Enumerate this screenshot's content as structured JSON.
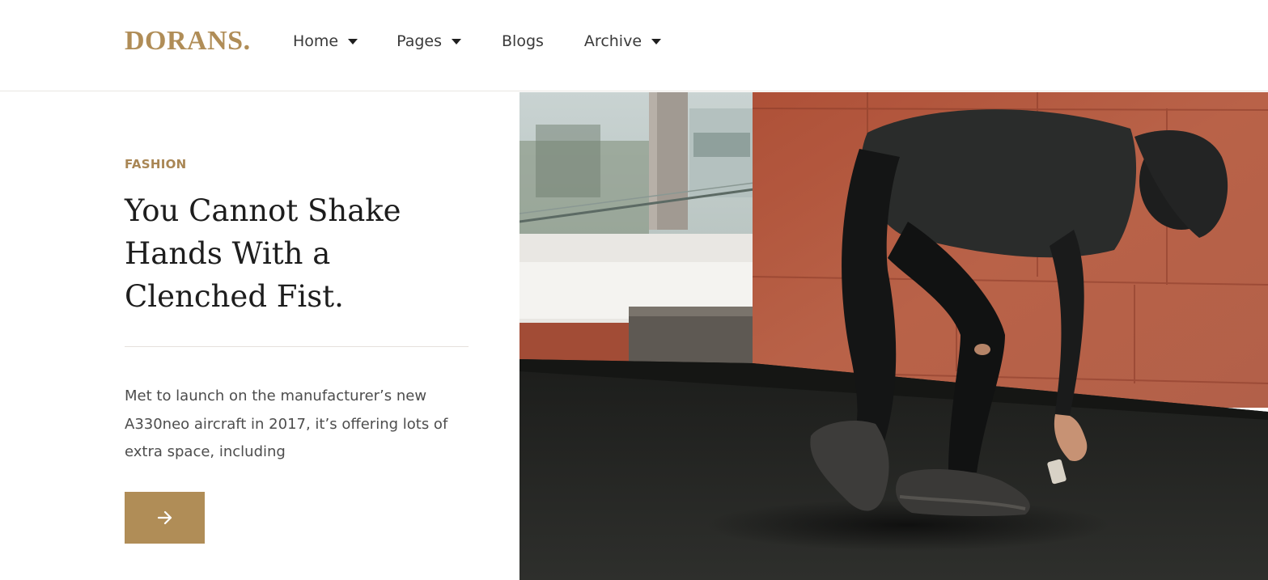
{
  "header": {
    "logo": "DORANS.",
    "nav": [
      {
        "label": "Home",
        "has_dropdown": true
      },
      {
        "label": "Pages",
        "has_dropdown": true
      },
      {
        "label": "Blogs",
        "has_dropdown": false
      },
      {
        "label": "Archive",
        "has_dropdown": true
      }
    ]
  },
  "hero": {
    "category": "FASHION",
    "title": "You Cannot Shake Hands With a Clenched Fist.",
    "excerpt": "Met to launch on the manufacturer’s new A330neo aircraft in 2017, it’s offering lots of extra space, including",
    "button_icon": "arrow-right-icon",
    "image_subject": "person in black outfit and bucket hat bending down on a rooftop beside a red stone wall"
  },
  "colors": {
    "accent": "#b08d57",
    "text_dark": "#1d1d1d",
    "text_body": "#4d4d4d"
  }
}
